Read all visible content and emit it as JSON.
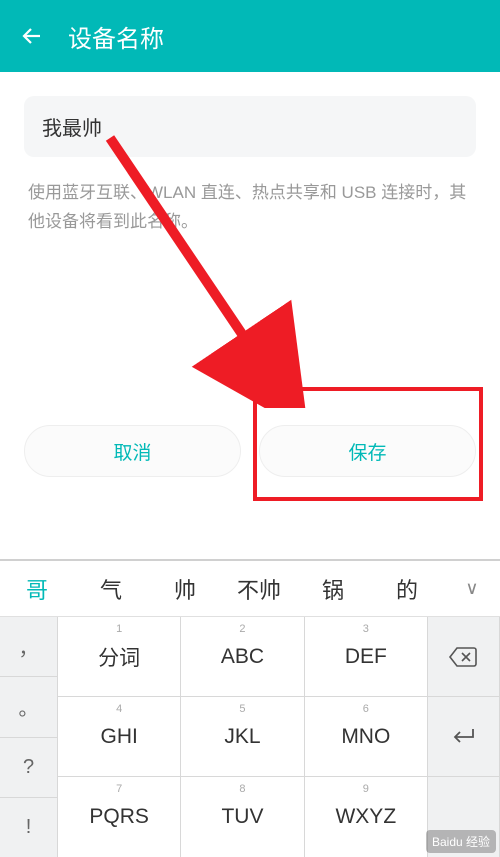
{
  "header": {
    "title": "设备名称"
  },
  "input": {
    "value": "我最帅"
  },
  "help": "使用蓝牙互联、WLAN 直连、热点共享和 USB 连接时，其他设备将看到此名称。",
  "buttons": {
    "cancel": "取消",
    "save": "保存"
  },
  "candidates": [
    "哥",
    "气",
    "帅",
    "不帅",
    "锅",
    "的"
  ],
  "sidekeys": [
    "，",
    "。",
    "?",
    "!"
  ],
  "row1": [
    {
      "n": "1",
      "l": "分词"
    },
    {
      "n": "2",
      "l": "ABC"
    },
    {
      "n": "3",
      "l": "DEF"
    }
  ],
  "row2": [
    {
      "n": "4",
      "l": "GHI"
    },
    {
      "n": "5",
      "l": "JKL"
    },
    {
      "n": "6",
      "l": "MNO"
    }
  ],
  "row3": [
    {
      "n": "7",
      "l": "PQRS"
    },
    {
      "n": "8",
      "l": "TUV"
    },
    {
      "n": "9",
      "l": "WXYZ"
    }
  ],
  "badge": "Baidu 经验"
}
